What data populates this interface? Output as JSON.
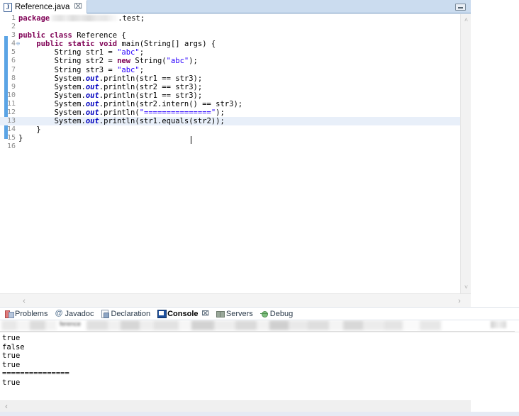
{
  "editor": {
    "tab": {
      "icon": "java-file-icon",
      "label": "Reference.java",
      "close": "⌧"
    },
    "minimize_tooltip": "Minimize",
    "code_lines": [
      {
        "n": "1",
        "fold": "",
        "html": "package|BLUR|.test;"
      },
      {
        "n": "2",
        "fold": "",
        "html": ""
      },
      {
        "n": "3",
        "fold": "",
        "html": "public class Reference {"
      },
      {
        "n": "4",
        "fold": "⊖",
        "html": "    public static void main(String[] args) {"
      },
      {
        "n": "5",
        "fold": "",
        "html": "        String str1 = \"abc\";"
      },
      {
        "n": "6",
        "fold": "",
        "html": "        String str2 = new String(\"abc\");"
      },
      {
        "n": "7",
        "fold": "",
        "html": "        String str3 = \"abc\";"
      },
      {
        "n": "8",
        "fold": "",
        "html": "        System.out.println(str1 == str3);"
      },
      {
        "n": "9",
        "fold": "",
        "html": "        System.out.println(str2 == str3);"
      },
      {
        "n": "10",
        "fold": "",
        "html": "        System.out.println(str1 == str3);"
      },
      {
        "n": "11",
        "fold": "",
        "html": "        System.out.println(str2.intern() == str3);"
      },
      {
        "n": "12",
        "fold": "",
        "html": "        System.out.println(\"===============\");"
      },
      {
        "n": "13",
        "fold": "",
        "html": "        System.out.println(str1.equals(str2));"
      },
      {
        "n": "14",
        "fold": "",
        "html": "    }"
      },
      {
        "n": "15",
        "fold": "",
        "html": "}"
      },
      {
        "n": "16",
        "fold": "",
        "html": ""
      }
    ],
    "current_line": "13",
    "scroll": {
      "left_arrow": "‹",
      "right_arrow": "›",
      "up_arrow": "˄",
      "down_arrow": "˅"
    }
  },
  "bottom_panel": {
    "tabs": [
      {
        "label": "Problems",
        "icon": "problems-icon",
        "active": false,
        "close": ""
      },
      {
        "label": "Javadoc",
        "icon": "javadoc-icon",
        "active": false,
        "close": ""
      },
      {
        "label": "Declaration",
        "icon": "declaration-icon",
        "active": false,
        "close": ""
      },
      {
        "label": "Console",
        "icon": "console-icon",
        "active": true,
        "close": "⌧"
      },
      {
        "label": "Servers",
        "icon": "servers-icon",
        "active": false,
        "close": ""
      },
      {
        "label": "Debug",
        "icon": "debug-icon",
        "active": false,
        "close": ""
      }
    ],
    "toolbar_redacted_label": "ference",
    "console_output": [
      "true",
      "false",
      "true",
      "true",
      "===============",
      "true"
    ],
    "scroll": {
      "left_arrow": "‹"
    }
  }
}
